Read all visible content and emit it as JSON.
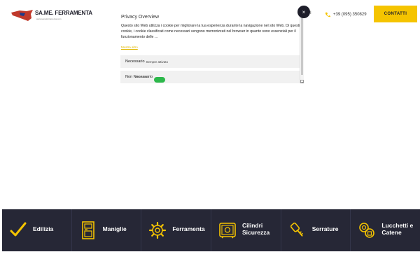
{
  "header": {
    "logo_text": "SA.ME. FERRAMENTA",
    "logo_sub": "www.sameferramenta.com",
    "nav_fragment": "I",
    "phone": "+39 (095) 350829",
    "contatti_label": "CONTATTI"
  },
  "privacy": {
    "title": "Privacy Overview",
    "body": "Questo sito Web utilizza i cookie per migliorare la tua esperienza durante la navigazione nel sito Web. Di questi cookie, i cookie classificati come necessari vengono memorizzati nel browser in quanto sono essenziali per il funzionamento delle ...",
    "more_link": "Mostra altro",
    "rows": [
      {
        "label": "Necessario",
        "badge": "Sempre attivato"
      },
      {
        "label": "Non Necessario",
        "overlay": "Necessario"
      }
    ],
    "close_symbol": "×",
    "scroll_arrow": "▾"
  },
  "categories": [
    {
      "label": "Edilizia",
      "icon": "check-icon"
    },
    {
      "label": "Maniglie",
      "icon": "door-icon"
    },
    {
      "label": "Ferramenta",
      "icon": "gear-icon"
    },
    {
      "label": "Cilindri Sicurezza",
      "icon": "safe-icon"
    },
    {
      "label": "Serrature",
      "icon": "key-icon"
    },
    {
      "label": "Lucchetti e Catene",
      "icon": "padlock-icon"
    }
  ],
  "colors": {
    "accent": "#f5c400",
    "dark": "#262736",
    "toggle": "#2db84b"
  }
}
